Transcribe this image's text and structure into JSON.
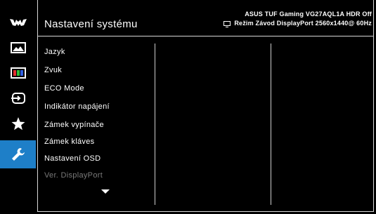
{
  "header": {
    "title": "Nastavení systému",
    "model_info": "ASUS TUF Gaming  VG27AQL1A HDR Off",
    "mode_info": "Režim Závod  DisplayPort  2560x1440@ 60Hz"
  },
  "sidebar": {
    "items": [
      {
        "icon": "tuf-logo-icon"
      },
      {
        "icon": "image-icon"
      },
      {
        "icon": "color-icon"
      },
      {
        "icon": "input-select-icon"
      },
      {
        "icon": "favorite-star-icon"
      },
      {
        "icon": "wrench-icon",
        "active": true
      }
    ],
    "active_color": "#1e7fc8"
  },
  "menu": {
    "items": [
      {
        "label": "Jazyk"
      },
      {
        "label": "Zvuk"
      },
      {
        "label": "ECO Mode"
      },
      {
        "label": "Indikátor napájení"
      },
      {
        "label": "Zámek vypínače"
      },
      {
        "label": "Zámek kláves"
      },
      {
        "label": "Nastavení OSD"
      },
      {
        "label": "Ver. DisplayPort",
        "disabled": true
      }
    ],
    "more_indicator": "chevron-down-icon"
  }
}
